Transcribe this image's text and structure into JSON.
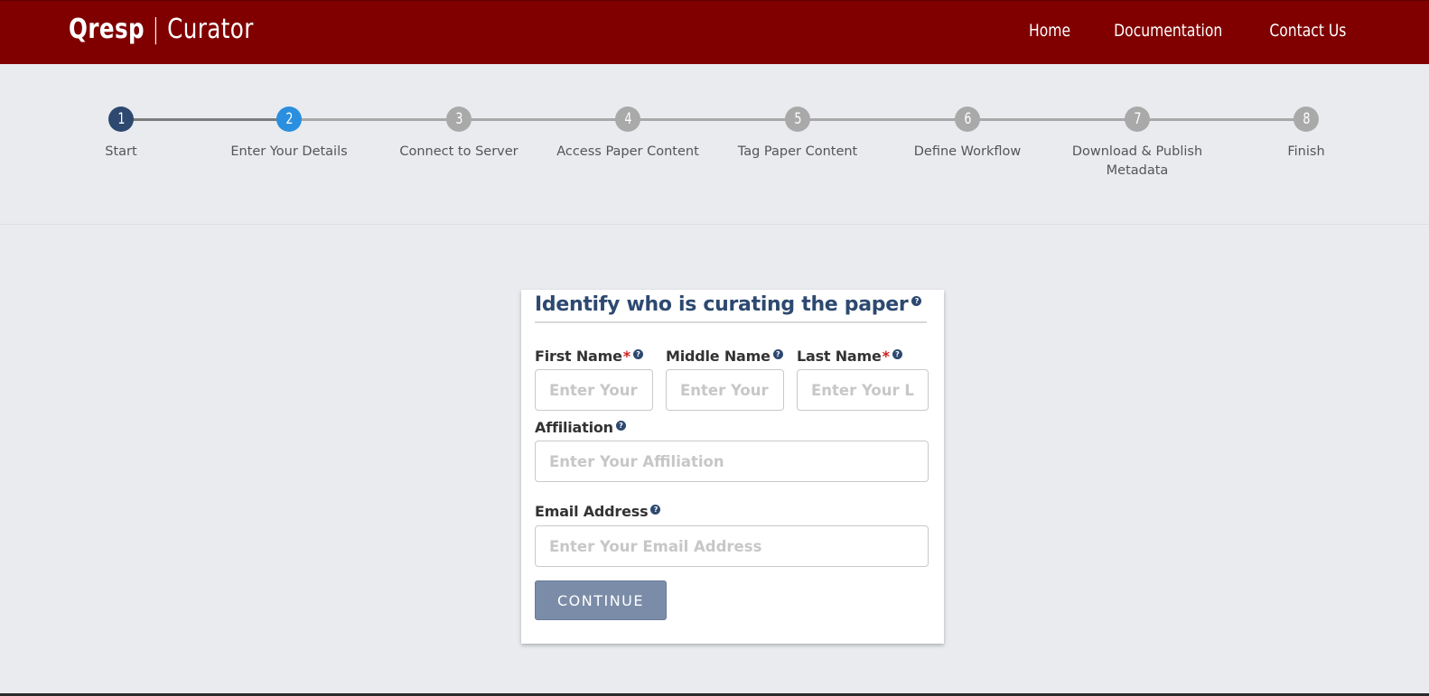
{
  "navbar": {
    "brand_main": "Qresp",
    "brand_sep": "|",
    "brand_sub": "Curator",
    "links": [
      "Home",
      "Documentation",
      "Contact Us"
    ]
  },
  "stepper": {
    "current_step": 2,
    "steps": [
      {
        "num": "1",
        "label": "Start",
        "state": "done"
      },
      {
        "num": "2",
        "label": "Enter Your Details",
        "state": "active"
      },
      {
        "num": "3",
        "label": "Connect to Server",
        "state": "pending"
      },
      {
        "num": "4",
        "label": "Access Paper Content",
        "state": "pending"
      },
      {
        "num": "5",
        "label": "Tag Paper Content",
        "state": "pending"
      },
      {
        "num": "6",
        "label": "Define Workflow",
        "state": "pending"
      },
      {
        "num": "7",
        "label": "Download & Publish Metadata",
        "state": "pending"
      },
      {
        "num": "8",
        "label": "Finish",
        "state": "pending"
      }
    ]
  },
  "form": {
    "title": "Identify who is curating the paper",
    "help_glyph": "?",
    "required_marker": "*",
    "first_name": {
      "label": "First Name",
      "placeholder": "Enter Your First Name",
      "value": ""
    },
    "middle_name": {
      "label": "Middle Name",
      "placeholder": "Enter Your Middle Name",
      "value": ""
    },
    "last_name": {
      "label": "Last Name",
      "placeholder": "Enter Your Last Name",
      "value": ""
    },
    "affiliation": {
      "label": "Affiliation",
      "placeholder": "Enter Your Affiliation",
      "value": ""
    },
    "email": {
      "label": "Email Address",
      "placeholder": "Enter Your Email Address",
      "value": ""
    },
    "continue_label": "CONTINUE"
  },
  "colors": {
    "navbar_bg": "#800000",
    "step_done": "#2d4970",
    "step_active": "#2a8fdf",
    "step_pending": "#a9a9a9",
    "title_color": "#2d4970",
    "required": "#d21f1f",
    "button_bg": "#7b8ca8"
  },
  "icons": {
    "help": "question-circle-icon"
  }
}
